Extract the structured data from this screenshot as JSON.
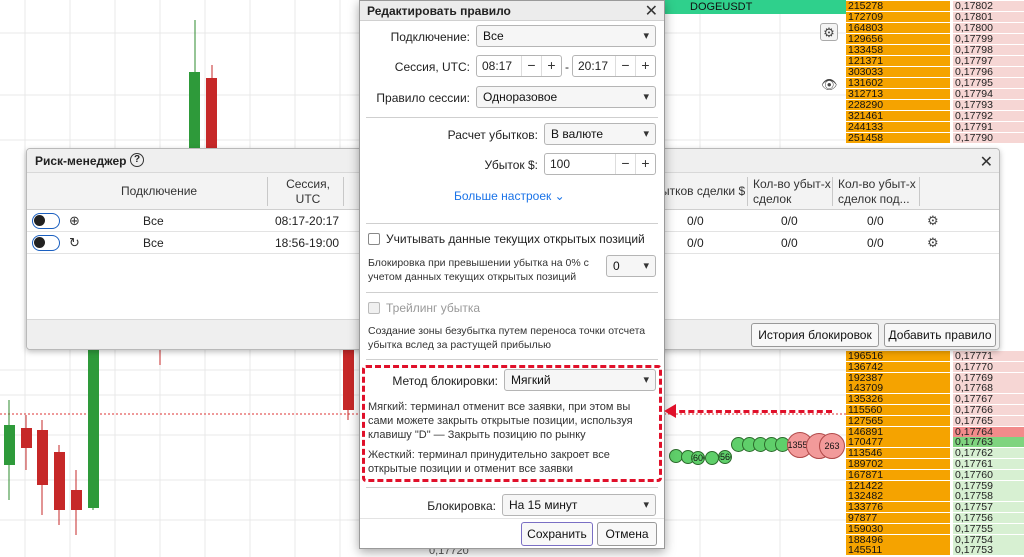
{
  "chart": {
    "price_label": "0,17720",
    "symbol": "DOGEUSDT"
  },
  "orderbook": {
    "asks": [
      {
        "vol": "215278",
        "price": "0,17802"
      },
      {
        "vol": "172709",
        "price": "0,17801"
      },
      {
        "vol": "164803",
        "price": "0,17800"
      },
      {
        "vol": "129656",
        "price": "0,17799"
      },
      {
        "vol": "133458",
        "price": "0,17798"
      },
      {
        "vol": "121371",
        "price": "0,17797"
      },
      {
        "vol": "303033",
        "price": "0,17796"
      },
      {
        "vol": "131602",
        "price": "0,17795"
      },
      {
        "vol": "312713",
        "price": "0,17794"
      },
      {
        "vol": "228290",
        "price": "0,17793"
      },
      {
        "vol": "321461",
        "price": "0,17792"
      },
      {
        "vol": "244133",
        "price": "0,17791"
      },
      {
        "vol": "251458",
        "price": "0,17790"
      }
    ],
    "lower": [
      {
        "vol": "196516",
        "price": "0,17771",
        "side": "ask"
      },
      {
        "vol": "136742",
        "price": "0,17770",
        "side": "ask"
      },
      {
        "vol": "192387",
        "price": "0,17769",
        "side": "ask"
      },
      {
        "vol": "143709",
        "price": "0,17768",
        "side": "ask"
      },
      {
        "vol": "135326",
        "price": "0,17767",
        "side": "ask"
      },
      {
        "vol": "115560",
        "price": "0,17766",
        "side": "ask"
      },
      {
        "vol": "127565",
        "price": "0,17765",
        "side": "ask"
      },
      {
        "vol": "146891",
        "price": "0,17764",
        "side": "hl-ask"
      },
      {
        "vol": "170477",
        "price": "0,17763",
        "side": "hl-bid"
      },
      {
        "vol": "113546",
        "price": "0,17762",
        "side": "bid"
      },
      {
        "vol": "189702",
        "price": "0,17761",
        "side": "bid"
      },
      {
        "vol": "167871",
        "price": "0,17760",
        "side": "bid"
      },
      {
        "vol": "121422",
        "price": "0,17759",
        "side": "bid"
      },
      {
        "vol": "132482",
        "price": "0,17758",
        "side": "bid"
      },
      {
        "vol": "133776",
        "price": "0,17757",
        "side": "bid"
      },
      {
        "vol": "97877",
        "price": "0,17756",
        "side": "bid"
      },
      {
        "vol": "159030",
        "price": "0,17755",
        "side": "bid"
      },
      {
        "vol": "188496",
        "price": "0,17754",
        "side": "bid"
      },
      {
        "vol": "145511",
        "price": "0,17753",
        "side": "bid"
      }
    ]
  },
  "bubbles": {
    "labels": [
      "3600",
      "9566",
      "13558",
      "263"
    ]
  },
  "risk_manager": {
    "title": "Риск-менеджер",
    "help_icon": "?",
    "columns": {
      "connection": "Подключение",
      "session": "Сессия, UTC",
      "loss_trade": "ытков сделки $",
      "loss_count_trades": "Кол-во убыт-х сделок",
      "loss_count_sub": "Кол-во убыт-х сделок под..."
    },
    "rows": [
      {
        "connection": "Все",
        "session": "08:17-20:17",
        "v1": "0/0",
        "v2": "0/0",
        "v3": "0/0"
      },
      {
        "connection": "Все",
        "session": "18:56-19:00",
        "v1": "0/0",
        "v2": "0/0",
        "v3": "0/0"
      }
    ],
    "btn_history": "История блокировок",
    "btn_add_rule": "Добавить правило"
  },
  "edit_rule": {
    "title": "Редактировать правило",
    "connection_label": "Подключение:",
    "connection_value": "Все",
    "session_label": "Сессия, UTC:",
    "session_from": "08:17",
    "session_to": "20:17",
    "session_dash": "-",
    "session_rule_label": "Правило сессии:",
    "session_rule_value": "Одноразовое",
    "loss_calc_label": "Расчет убытков:",
    "loss_calc_value": "В валюте",
    "loss_label": "Убыток $:",
    "loss_value": "100",
    "more_settings": "Больше настроек",
    "consider_open_label": "Учитывать данные текущих открытых позиций",
    "block_exceed_text": "Блокировка при превышении убытка на 0% с учетом данных текущих открытых позиций",
    "block_exceed_value": "0",
    "trailing_label": "Трейлинг убытка",
    "breakeven_text": "Создание зоны безубытка путем переноса точки отсчета убытка вслед за растущей прибылью",
    "method_label": "Метод блокировки:",
    "method_value": "Мягкий",
    "soft_desc": "Мягкий: терминал отменит все заявки, при этом вы сами можете закрыть открытые позиции, используя клавишу \"D\" — Закрыть позицию по рынку",
    "hard_desc": "Жесткий: терминал принудительно закроет все открытые позиции и отменит все заявки",
    "block_label": "Блокировка:",
    "block_value": "На 15 минут",
    "save": "Сохранить",
    "cancel": "Отмена"
  },
  "colors": {
    "orderbook_volume": "#f5a300",
    "highlight": "#e0102a",
    "link": "#1a73e8"
  }
}
